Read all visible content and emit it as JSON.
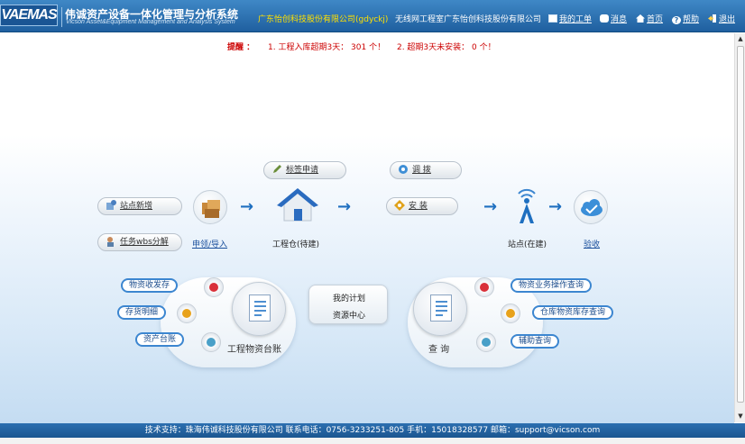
{
  "header": {
    "logo": "VAEMAS",
    "title": "伟诚资产设备一体化管理与分析系统",
    "subtitle": "Vicson Asset&Equipment Management and Analysis System",
    "company": "广东怡创科技股份有限公司(gdyckj)",
    "department": "无线网工程室广东怡创科技股份有限公司",
    "nav": {
      "work_orders": "我的工单",
      "messages": "消息",
      "home": "首页",
      "help": "帮助",
      "logout": "退出"
    }
  },
  "reminder": {
    "label": "提醒 ：",
    "item1": "1. 工程入库超期3天： 301 个！",
    "item2": "2. 超期3天未安装： 0 个！"
  },
  "flow": {
    "site_add": "站点新增",
    "task_wbs": "任务wbs分解",
    "apply_import": "申领/导入",
    "label_apply": "标签申请",
    "warehouse": "工程仓(待建)",
    "transfer": "调 拨",
    "install": "安 装",
    "site_built": "站点(在建)",
    "acceptance": "验收"
  },
  "left_panel": {
    "title": "工程物资台账",
    "items": [
      "物资收发存",
      "存货明细",
      "资产台账"
    ]
  },
  "middle": {
    "plan": "我的计划",
    "resource": "资源中心"
  },
  "right_panel": {
    "title": "查 询",
    "items": [
      "物资业务操作查询",
      "仓库物资库存查询",
      "辅助查询"
    ]
  },
  "footer": {
    "text": "技术支持：珠海伟诚科技股份有限公司 联系电话：0756-3233251-805 手机：15018328577 邮箱：support@vicson.com"
  },
  "colors": {
    "header_blue": "#2c6fb0",
    "reminder_red": "#cc0000",
    "company_yellow": "#ffe000",
    "dot_red": "#d9303a",
    "dot_orange": "#e8a21b",
    "dot_blue": "#4aa0c8"
  }
}
